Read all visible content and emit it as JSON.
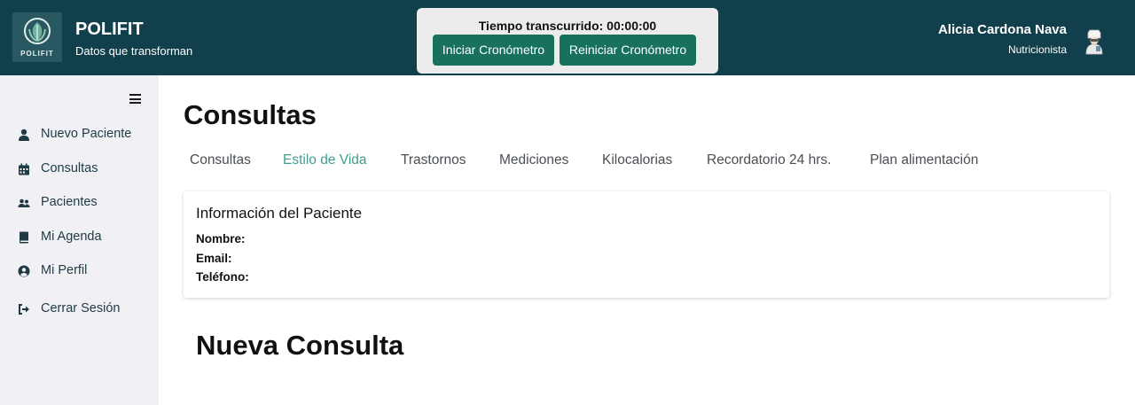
{
  "header": {
    "logo_text": "POLIFIT",
    "brand_name": "POLIFIT",
    "brand_tagline": "Datos que transforman",
    "timer_label": "Tiempo transcurrido: 00:00:00",
    "start_button": "Iniciar Cronómetro",
    "reset_button": "Reiniciar Cronómetro",
    "user_name": "Alicia Cardona Nava",
    "user_role": "Nutricionista",
    "avatar_icon": "chef-avatar-icon"
  },
  "sidebar": {
    "menu_icon": "hamburger-icon",
    "items": [
      {
        "label": "Nuevo Paciente",
        "icon": "user-icon"
      },
      {
        "label": "Consultas",
        "icon": "calendar-icon"
      },
      {
        "label": "Pacientes",
        "icon": "users-icon"
      },
      {
        "label": "Mi Agenda",
        "icon": "book-icon"
      },
      {
        "label": "Mi Perfil",
        "icon": "user-circle-icon"
      },
      {
        "label": "Cerrar Sesión",
        "icon": "sign-out-icon"
      }
    ]
  },
  "main": {
    "page_title": "Consultas",
    "tabs": [
      {
        "label": "Consultas",
        "active": false
      },
      {
        "label": "Estilo de Vida",
        "active": true
      },
      {
        "label": "Trastornos",
        "active": false
      },
      {
        "label": "Mediciones",
        "active": false
      },
      {
        "label": "Kilocalorias",
        "active": false
      },
      {
        "label": "Recordatorio 24 hrs.",
        "active": false
      },
      {
        "label": "Plan alimentación",
        "active": false
      }
    ],
    "patient_card": {
      "title": "Información del Paciente",
      "name_label": "Nombre:",
      "email_label": "Email:",
      "phone_label": "Teléfono:"
    },
    "section_title": "Nueva Consulta"
  },
  "colors": {
    "header_bg": "#123f4c",
    "button_bg": "#17715d",
    "active_tab": "#3f9d8f",
    "sidebar_bg": "#f1f1f5"
  }
}
